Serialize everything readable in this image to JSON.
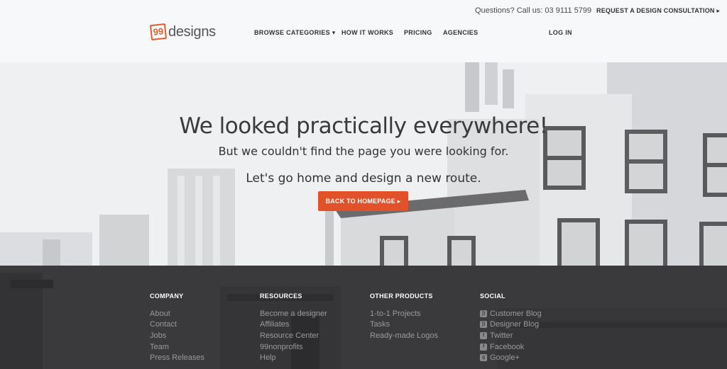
{
  "topbar": {
    "questions_text": "Questions? Call us: 03 9111 5799",
    "consultation_link": "REQUEST A DESIGN CONSULTATION ▸"
  },
  "header": {
    "logo_badge": "99",
    "logo_text": "designs",
    "nav": {
      "browse": "BROWSE CATEGORIES ▾",
      "how": "HOW IT WORKS",
      "pricing": "PRICING",
      "agencies": "AGENCIES",
      "login": "LOG IN"
    }
  },
  "hero": {
    "title": "We looked practically everywhere!",
    "subtitle": "But we couldn't find the page you were looking for.",
    "cta_text": "Let's go home and design a new route.",
    "button_label": "BACK TO HOMEPAGE ▸"
  },
  "footer": {
    "company": {
      "title": "COMPANY",
      "links": [
        "About",
        "Contact",
        "Jobs",
        "Team",
        "Press Releases"
      ]
    },
    "resources": {
      "title": "RESOURCES",
      "links": [
        "Become a designer",
        "Affiliates",
        "Resource Center",
        "99nonprofits",
        "Help"
      ]
    },
    "products": {
      "title": "OTHER PRODUCTS",
      "links": [
        "1-to-1 Projects",
        "Tasks",
        "Ready-made Logos"
      ]
    },
    "social": {
      "title": "SOCIAL",
      "links": [
        {
          "label": "Customer Blog",
          "icon": "rss-icon"
        },
        {
          "label": "Designer Blog",
          "icon": "rss-icon"
        },
        {
          "label": "Twitter",
          "icon": "twitter-icon"
        },
        {
          "label": "Facebook",
          "icon": "facebook-icon"
        },
        {
          "label": "Google+",
          "icon": "google-plus-icon"
        }
      ]
    }
  },
  "colors": {
    "accent": "#e1522b",
    "footer_bg": "#3a3a3c",
    "header_bg": "#f6f8fa"
  }
}
